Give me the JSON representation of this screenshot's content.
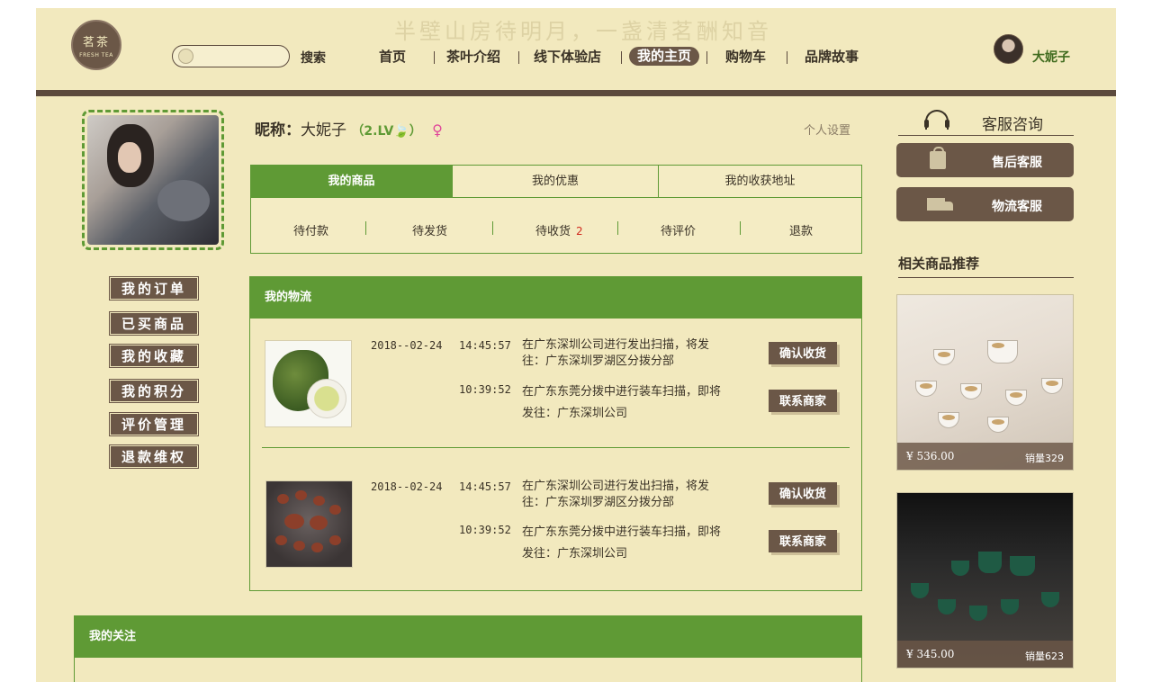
{
  "header": {
    "slogan": "半壁山房待明月，一盏清茗酬知音",
    "logo_cn": "茗茶",
    "logo_en": "FRESH TEA",
    "search_placeholder": "",
    "search_label": "搜索",
    "nav": [
      "首页",
      "茶叶介绍",
      "线下体验店",
      "我的主页",
      "购物车",
      "品牌故事"
    ],
    "active_nav_index": 3,
    "user_name": "大妮子"
  },
  "sidebar": {
    "menu": [
      "我的订单",
      "已买商品",
      "我的收藏",
      "我的积分",
      "评价管理",
      "退款维权"
    ]
  },
  "profile": {
    "nickname_label": "昵称：",
    "nickname": "大妮子",
    "level": "（2.LV🍃）",
    "gender_icon": "female-icon",
    "settings_label": "个人设置"
  },
  "tabs": {
    "items": [
      "我的商品",
      "我的优惠",
      "我的收获地址"
    ],
    "active_index": 0,
    "subtabs": [
      "待付款",
      "待发货",
      "待收货",
      "待评价",
      "退款"
    ],
    "pending_receive_count": "2"
  },
  "logistics": {
    "title": "我的物流",
    "entries": [
      {
        "product_icon": "tea-leaves-thumbnail",
        "date": "2018--02-24",
        "events": [
          {
            "time": "14:45:57",
            "text": "在广东深圳公司进行发出扫描，将发往：广东深圳罗湖区分拨分部"
          },
          {
            "time": "10:39:52",
            "text": "在广东东莞分拨中进行装车扫描，即将发往：广东深圳公司"
          }
        ],
        "confirm_label": "确认收货",
        "contact_label": "联系商家"
      },
      {
        "product_icon": "tea-set-thumbnail",
        "date": "2018--02-24",
        "events": [
          {
            "time": "14:45:57",
            "text": "在广东深圳公司进行发出扫描，将发往：广东深圳罗湖区分拨分部"
          },
          {
            "time": "10:39:52",
            "text": "在广东东莞分拨中进行装车扫描，即将发往：广东深圳公司"
          }
        ],
        "confirm_label": "确认收货",
        "contact_label": "联系商家"
      }
    ]
  },
  "follow": {
    "title": "我的关注"
  },
  "customer_service": {
    "title": "客服咨询",
    "buttons": [
      "售后客服",
      "物流客服"
    ]
  },
  "recommend": {
    "title": "相关商品推荐",
    "items": [
      {
        "price": "¥ 536.00",
        "sales": "销量329"
      },
      {
        "price": "¥ 345.00",
        "sales": "销量623"
      }
    ]
  },
  "colors": {
    "background": "#f2e9be",
    "brown": "#6b5747",
    "green": "#5f9a35",
    "badge_red": "#d02a1e"
  }
}
